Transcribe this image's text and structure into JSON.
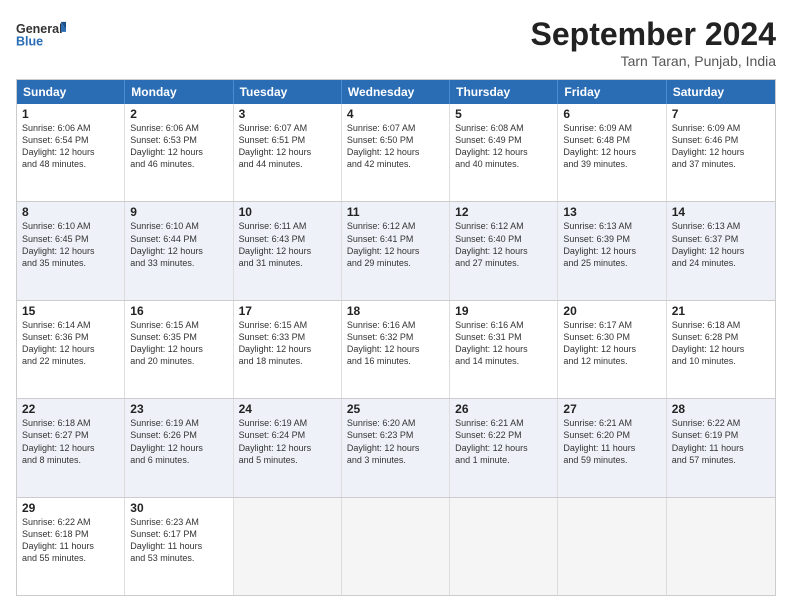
{
  "header": {
    "logo_general": "General",
    "logo_blue": "Blue",
    "month_title": "September 2024",
    "location": "Tarn Taran, Punjab, India"
  },
  "weekdays": [
    "Sunday",
    "Monday",
    "Tuesday",
    "Wednesday",
    "Thursday",
    "Friday",
    "Saturday"
  ],
  "rows": [
    [
      {
        "day": "1",
        "lines": [
          "Sunrise: 6:06 AM",
          "Sunset: 6:54 PM",
          "Daylight: 12 hours",
          "and 48 minutes."
        ]
      },
      {
        "day": "2",
        "lines": [
          "Sunrise: 6:06 AM",
          "Sunset: 6:53 PM",
          "Daylight: 12 hours",
          "and 46 minutes."
        ]
      },
      {
        "day": "3",
        "lines": [
          "Sunrise: 6:07 AM",
          "Sunset: 6:51 PM",
          "Daylight: 12 hours",
          "and 44 minutes."
        ]
      },
      {
        "day": "4",
        "lines": [
          "Sunrise: 6:07 AM",
          "Sunset: 6:50 PM",
          "Daylight: 12 hours",
          "and 42 minutes."
        ]
      },
      {
        "day": "5",
        "lines": [
          "Sunrise: 6:08 AM",
          "Sunset: 6:49 PM",
          "Daylight: 12 hours",
          "and 40 minutes."
        ]
      },
      {
        "day": "6",
        "lines": [
          "Sunrise: 6:09 AM",
          "Sunset: 6:48 PM",
          "Daylight: 12 hours",
          "and 39 minutes."
        ]
      },
      {
        "day": "7",
        "lines": [
          "Sunrise: 6:09 AM",
          "Sunset: 6:46 PM",
          "Daylight: 12 hours",
          "and 37 minutes."
        ]
      }
    ],
    [
      {
        "day": "8",
        "lines": [
          "Sunrise: 6:10 AM",
          "Sunset: 6:45 PM",
          "Daylight: 12 hours",
          "and 35 minutes."
        ]
      },
      {
        "day": "9",
        "lines": [
          "Sunrise: 6:10 AM",
          "Sunset: 6:44 PM",
          "Daylight: 12 hours",
          "and 33 minutes."
        ]
      },
      {
        "day": "10",
        "lines": [
          "Sunrise: 6:11 AM",
          "Sunset: 6:43 PM",
          "Daylight: 12 hours",
          "and 31 minutes."
        ]
      },
      {
        "day": "11",
        "lines": [
          "Sunrise: 6:12 AM",
          "Sunset: 6:41 PM",
          "Daylight: 12 hours",
          "and 29 minutes."
        ]
      },
      {
        "day": "12",
        "lines": [
          "Sunrise: 6:12 AM",
          "Sunset: 6:40 PM",
          "Daylight: 12 hours",
          "and 27 minutes."
        ]
      },
      {
        "day": "13",
        "lines": [
          "Sunrise: 6:13 AM",
          "Sunset: 6:39 PM",
          "Daylight: 12 hours",
          "and 25 minutes."
        ]
      },
      {
        "day": "14",
        "lines": [
          "Sunrise: 6:13 AM",
          "Sunset: 6:37 PM",
          "Daylight: 12 hours",
          "and 24 minutes."
        ]
      }
    ],
    [
      {
        "day": "15",
        "lines": [
          "Sunrise: 6:14 AM",
          "Sunset: 6:36 PM",
          "Daylight: 12 hours",
          "and 22 minutes."
        ]
      },
      {
        "day": "16",
        "lines": [
          "Sunrise: 6:15 AM",
          "Sunset: 6:35 PM",
          "Daylight: 12 hours",
          "and 20 minutes."
        ]
      },
      {
        "day": "17",
        "lines": [
          "Sunrise: 6:15 AM",
          "Sunset: 6:33 PM",
          "Daylight: 12 hours",
          "and 18 minutes."
        ]
      },
      {
        "day": "18",
        "lines": [
          "Sunrise: 6:16 AM",
          "Sunset: 6:32 PM",
          "Daylight: 12 hours",
          "and 16 minutes."
        ]
      },
      {
        "day": "19",
        "lines": [
          "Sunrise: 6:16 AM",
          "Sunset: 6:31 PM",
          "Daylight: 12 hours",
          "and 14 minutes."
        ]
      },
      {
        "day": "20",
        "lines": [
          "Sunrise: 6:17 AM",
          "Sunset: 6:30 PM",
          "Daylight: 12 hours",
          "and 12 minutes."
        ]
      },
      {
        "day": "21",
        "lines": [
          "Sunrise: 6:18 AM",
          "Sunset: 6:28 PM",
          "Daylight: 12 hours",
          "and 10 minutes."
        ]
      }
    ],
    [
      {
        "day": "22",
        "lines": [
          "Sunrise: 6:18 AM",
          "Sunset: 6:27 PM",
          "Daylight: 12 hours",
          "and 8 minutes."
        ]
      },
      {
        "day": "23",
        "lines": [
          "Sunrise: 6:19 AM",
          "Sunset: 6:26 PM",
          "Daylight: 12 hours",
          "and 6 minutes."
        ]
      },
      {
        "day": "24",
        "lines": [
          "Sunrise: 6:19 AM",
          "Sunset: 6:24 PM",
          "Daylight: 12 hours",
          "and 5 minutes."
        ]
      },
      {
        "day": "25",
        "lines": [
          "Sunrise: 6:20 AM",
          "Sunset: 6:23 PM",
          "Daylight: 12 hours",
          "and 3 minutes."
        ]
      },
      {
        "day": "26",
        "lines": [
          "Sunrise: 6:21 AM",
          "Sunset: 6:22 PM",
          "Daylight: 12 hours",
          "and 1 minute."
        ]
      },
      {
        "day": "27",
        "lines": [
          "Sunrise: 6:21 AM",
          "Sunset: 6:20 PM",
          "Daylight: 11 hours",
          "and 59 minutes."
        ]
      },
      {
        "day": "28",
        "lines": [
          "Sunrise: 6:22 AM",
          "Sunset: 6:19 PM",
          "Daylight: 11 hours",
          "and 57 minutes."
        ]
      }
    ],
    [
      {
        "day": "29",
        "lines": [
          "Sunrise: 6:22 AM",
          "Sunset: 6:18 PM",
          "Daylight: 11 hours",
          "and 55 minutes."
        ]
      },
      {
        "day": "30",
        "lines": [
          "Sunrise: 6:23 AM",
          "Sunset: 6:17 PM",
          "Daylight: 11 hours",
          "and 53 minutes."
        ]
      },
      {
        "day": "",
        "lines": []
      },
      {
        "day": "",
        "lines": []
      },
      {
        "day": "",
        "lines": []
      },
      {
        "day": "",
        "lines": []
      },
      {
        "day": "",
        "lines": []
      }
    ]
  ]
}
